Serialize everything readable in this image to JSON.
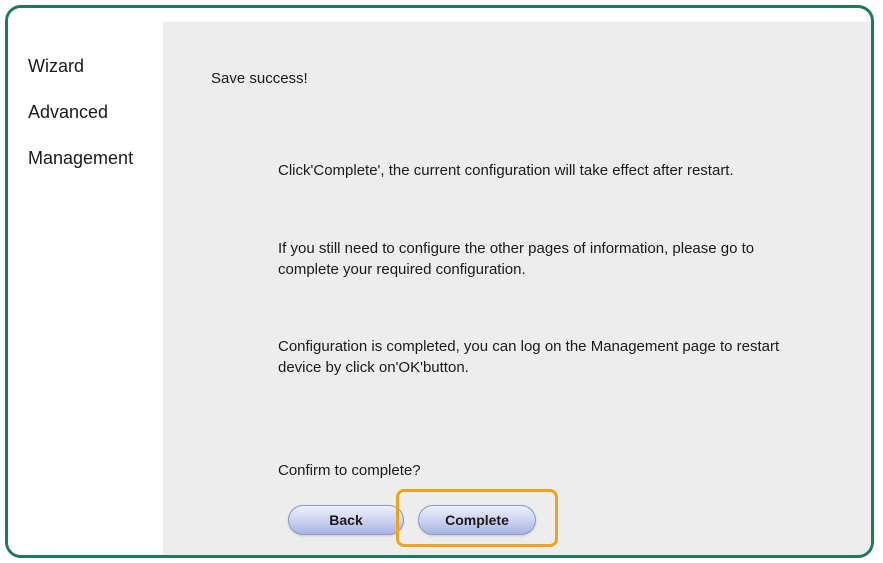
{
  "sidebar": {
    "items": [
      {
        "label": "Wizard"
      },
      {
        "label": "Advanced"
      },
      {
        "label": "Management"
      }
    ]
  },
  "main": {
    "status": "Save success!",
    "paragraphs": [
      "Click'Complete', the current configuration will take effect after restart.",
      "If you still need to configure the other pages of information, please go to complete your required configuration.",
      "Configuration is completed, you can log on the Management page to restart device by click on'OK'button."
    ],
    "confirm": "Confirm to complete?",
    "buttons": {
      "back": "Back",
      "complete": "Complete"
    }
  },
  "colors": {
    "frame_border": "#1f7a57",
    "highlight": "#f0a21b",
    "content_bg": "#ededed"
  }
}
